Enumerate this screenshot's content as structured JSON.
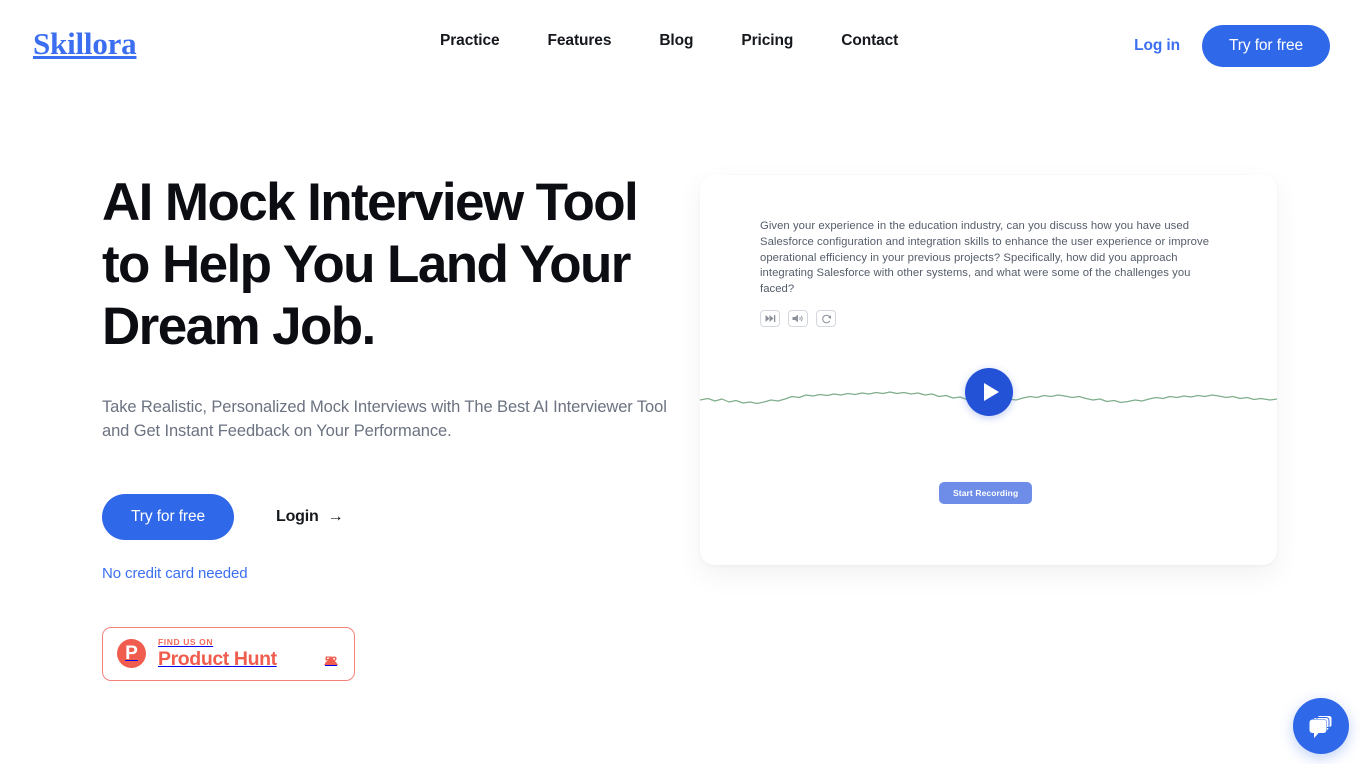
{
  "header": {
    "logo": "Skillora",
    "nav": [
      {
        "label": "Practice",
        "name": "nav-practice"
      },
      {
        "label": "Features",
        "name": "nav-features"
      },
      {
        "label": "Blog",
        "name": "nav-blog"
      },
      {
        "label": "Pricing",
        "name": "nav-pricing"
      },
      {
        "label": "Contact",
        "name": "nav-contact"
      }
    ],
    "login_label": "Log in",
    "try_free_label": "Try for free"
  },
  "hero": {
    "title": "AI Mock Interview Tool to Help You Land Your Dream Job.",
    "subtitle": "Take Realistic, Personalized Mock Interviews with The Best AI Interviewer Tool and Get Instant Feedback on Your Performance.",
    "primary_cta": "Try for free",
    "secondary_cta": "Login",
    "secondary_cta_arrow": "→",
    "no_credit_card": "No credit card needed"
  },
  "product_hunt": {
    "kicker": "FIND US ON",
    "name": "Product Hunt",
    "logo_letter": "P",
    "vote_count": "52",
    "accent_color": "#f05d4e"
  },
  "demo_card": {
    "question": "Given your experience in the education industry, can you discuss how you have used Salesforce configuration and integration skills to enhance the user experience or improve operational efficiency in your previous projects? Specifically, how did you approach integrating Salesforce with other systems, and what were some of the challenges you faced?",
    "controls": [
      {
        "name": "skip-forward-icon",
        "title": "Skip"
      },
      {
        "name": "volume-icon",
        "title": "Volume"
      },
      {
        "name": "refresh-icon",
        "title": "Repeat"
      }
    ],
    "play_button_label": "Play",
    "record_button_label": "Start Recording",
    "waveform_color": "#7fae8c"
  },
  "chat_widget": {
    "label": "Chat",
    "icon": "chat-bubbles-icon",
    "color": "#2f68e8"
  },
  "colors": {
    "brand_blue": "#2f68e8",
    "logo_blue": "#3b6ef0",
    "text_dark": "#0b0d12",
    "text_muted": "#6b7280",
    "page_bg": "#ffffff"
  }
}
